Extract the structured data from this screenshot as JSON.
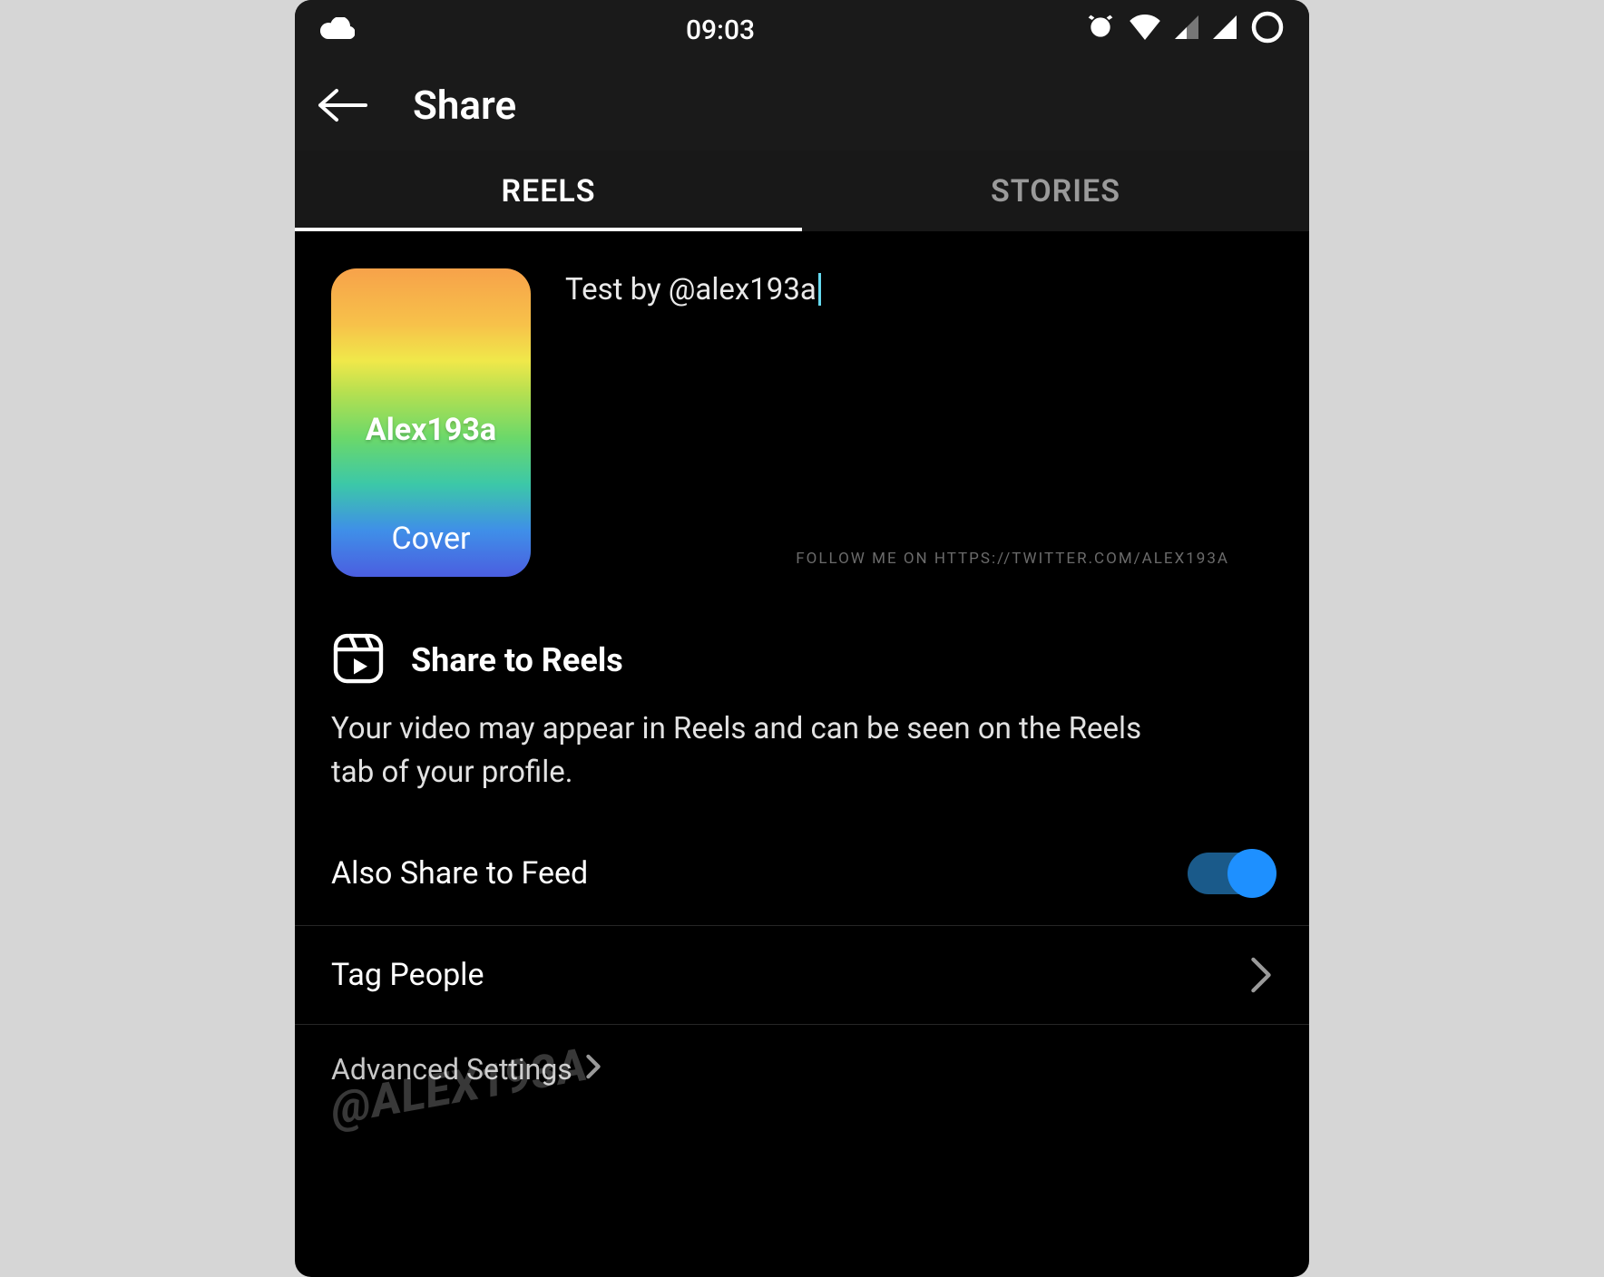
{
  "status": {
    "time": "09:03"
  },
  "header": {
    "title": "Share"
  },
  "tabs": {
    "reels": "REELS",
    "stories": "STORIES"
  },
  "caption": {
    "text": "Test by @alex193a",
    "cover_user": "Alex193a",
    "cover_label": "Cover"
  },
  "watermark": {
    "url": "FOLLOW ME ON HTTPS://TWITTER.COM/ALEX193A",
    "handle": "@ALEX193A"
  },
  "share_reels": {
    "title": "Share to Reels",
    "description": "Your video may appear in Reels and can be seen on the Reels tab of your profile."
  },
  "rows": {
    "also_share_feed": "Also Share to Feed",
    "tag_people": "Tag People",
    "advanced": "Advanced Settings"
  },
  "toggles": {
    "also_share_feed": true
  }
}
